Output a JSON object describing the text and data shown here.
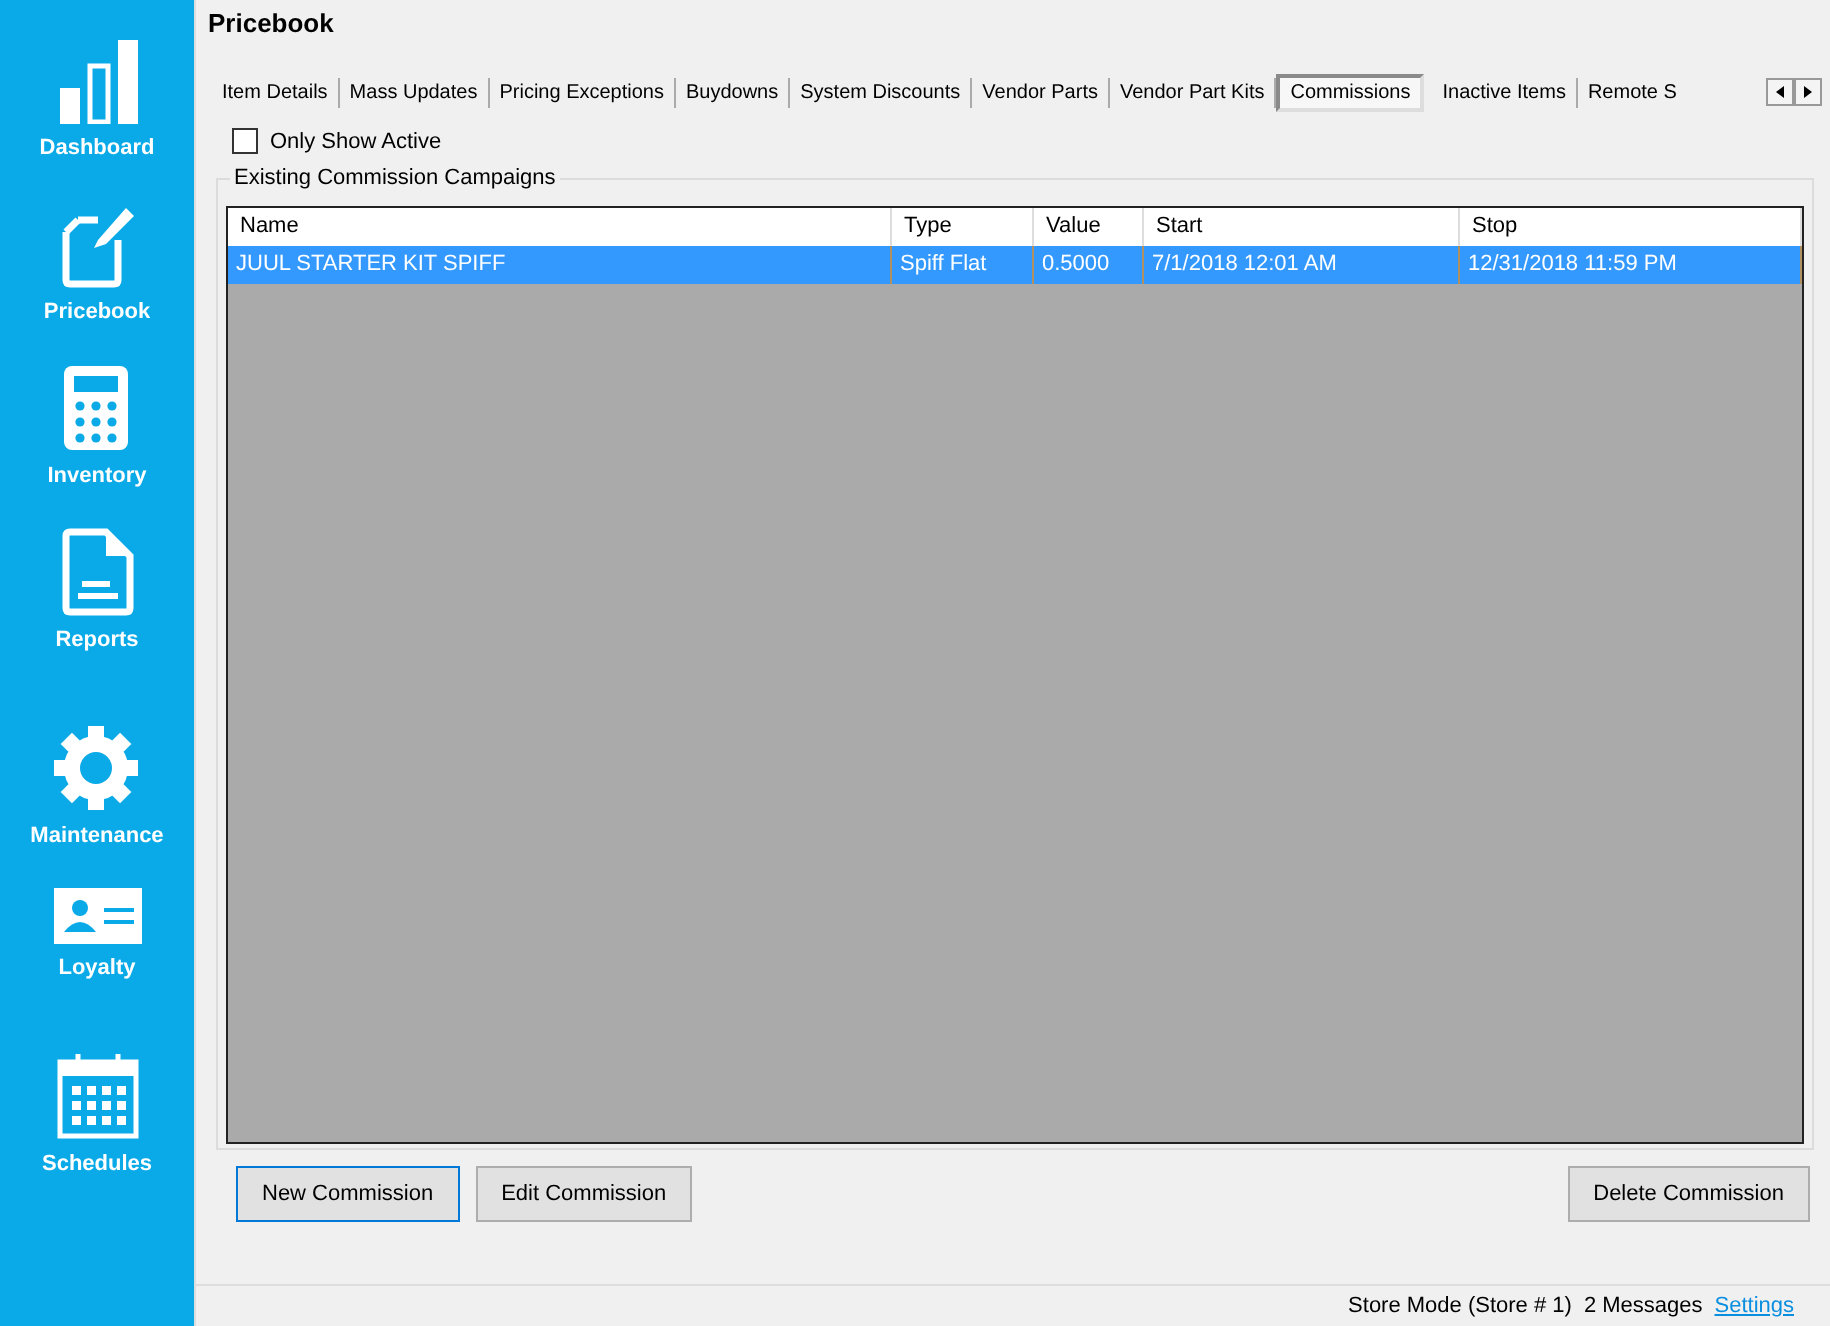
{
  "sidebar": {
    "items": [
      {
        "label": "Dashboard",
        "kind": "bars"
      },
      {
        "label": "Pricebook",
        "kind": "edit"
      },
      {
        "label": "Inventory",
        "kind": "calculator"
      },
      {
        "label": "Reports",
        "kind": "document"
      },
      {
        "label": "Maintenance",
        "kind": "gear"
      },
      {
        "label": "Loyalty",
        "kind": "card"
      },
      {
        "label": "Schedules",
        "kind": "calendar"
      }
    ]
  },
  "window": {
    "title": "Pricebook"
  },
  "tabs": [
    {
      "label": "Item Details",
      "selected": false
    },
    {
      "label": "Mass Updates",
      "selected": false
    },
    {
      "label": "Pricing Exceptions",
      "selected": false
    },
    {
      "label": "Buydowns",
      "selected": false
    },
    {
      "label": "System Discounts",
      "selected": false
    },
    {
      "label": "Vendor Parts",
      "selected": false
    },
    {
      "label": "Vendor Part Kits",
      "selected": false
    },
    {
      "label": "Commissions",
      "selected": true
    },
    {
      "label": "Inactive Items",
      "selected": false
    },
    {
      "label": "Remote S",
      "selected": false
    }
  ],
  "filter": {
    "label": "Only Show Active",
    "checked": false
  },
  "group": {
    "title": "Existing Commission Campaigns"
  },
  "table": {
    "columns": [
      "Name",
      "Type",
      "Value",
      "Start",
      "Stop"
    ],
    "rows": [
      {
        "cells": [
          "JUUL STARTER KIT SPIFF",
          "Spiff Flat",
          "0.5000",
          "7/1/2018 12:01 AM",
          "12/31/2018 11:59 PM"
        ],
        "selected": true
      }
    ]
  },
  "buttons": {
    "left": [
      "New Commission",
      "Edit Commission"
    ],
    "right": [
      "Delete Commission"
    ]
  },
  "status_bar": {
    "mode": "Store Mode (Store # 1)",
    "messages": "2 Messages",
    "link": "Settings"
  }
}
